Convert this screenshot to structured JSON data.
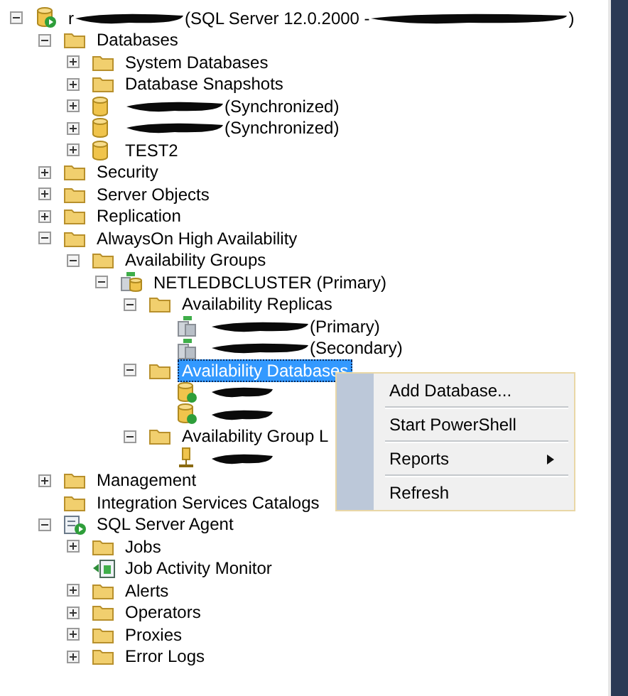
{
  "tree": [
    {
      "kind": "server",
      "expanded": true,
      "selected": false,
      "segments": [
        {
          "kind": "text",
          "text": "r"
        },
        {
          "kind": "redaction"
        },
        {
          "kind": "text",
          "text": "(SQL Server 12.0.2000 - "
        },
        {
          "kind": "redaction"
        },
        {
          "kind": "text",
          "text": ")"
        }
      ],
      "children": [
        {
          "kind": "folder",
          "expanded": true,
          "selected": false,
          "label": "Databases",
          "children": [
            {
              "kind": "folder",
              "expanded": false,
              "selected": false,
              "label": "System Databases"
            },
            {
              "kind": "folder",
              "expanded": false,
              "selected": false,
              "label": "Database Snapshots"
            },
            {
              "kind": "database",
              "expanded": false,
              "selected": false,
              "segments": [
                {
                  "kind": "redaction"
                },
                {
                  "kind": "text",
                  "text": "(Synchronized)"
                }
              ]
            },
            {
              "kind": "database",
              "expanded": false,
              "selected": false,
              "segments": [
                {
                  "kind": "redaction"
                },
                {
                  "kind": "text",
                  "text": "(Synchronized)"
                }
              ]
            },
            {
              "kind": "database",
              "expanded": false,
              "selected": false,
              "label": "TEST2"
            }
          ]
        },
        {
          "kind": "folder",
          "expanded": false,
          "selected": false,
          "label": "Security"
        },
        {
          "kind": "folder",
          "expanded": false,
          "selected": false,
          "label": "Server Objects"
        },
        {
          "kind": "folder",
          "expanded": false,
          "selected": false,
          "label": "Replication"
        },
        {
          "kind": "folder",
          "expanded": true,
          "selected": false,
          "label": "AlwaysOn High Availability",
          "children": [
            {
              "kind": "folder",
              "expanded": true,
              "selected": false,
              "label": "Availability Groups",
              "children": [
                {
                  "kind": "group",
                  "expanded": true,
                  "selected": false,
                  "label": "NETLEDBCLUSTER (Primary)",
                  "children": [
                    {
                      "kind": "folder",
                      "expanded": true,
                      "selected": false,
                      "label": "Availability Replicas",
                      "children": [
                        {
                          "kind": "replica",
                          "selected": false,
                          "segments": [
                            {
                              "kind": "redaction"
                            },
                            {
                              "kind": "text",
                              "text": "(Primary)"
                            }
                          ]
                        },
                        {
                          "kind": "replica",
                          "selected": false,
                          "segments": [
                            {
                              "kind": "redaction"
                            },
                            {
                              "kind": "text",
                              "text": "(Secondary)"
                            }
                          ]
                        }
                      ]
                    },
                    {
                      "kind": "folder",
                      "expanded": true,
                      "selected": true,
                      "label": "Availability Databases",
                      "children": [
                        {
                          "kind": "avdb",
                          "selected": false,
                          "segments": [
                            {
                              "kind": "redaction"
                            }
                          ]
                        },
                        {
                          "kind": "avdb",
                          "selected": false,
                          "segments": [
                            {
                              "kind": "redaction"
                            }
                          ]
                        }
                      ]
                    },
                    {
                      "kind": "folder",
                      "expanded": true,
                      "selected": false,
                      "label": "Availability Group L",
                      "children": [
                        {
                          "kind": "listener",
                          "selected": false,
                          "segments": [
                            {
                              "kind": "redaction"
                            }
                          ]
                        }
                      ]
                    }
                  ]
                }
              ]
            }
          ]
        },
        {
          "kind": "folder",
          "expanded": false,
          "selected": false,
          "label": "Management"
        },
        {
          "kind": "folder",
          "selected": false,
          "label": "Integration Services Catalogs"
        },
        {
          "kind": "agent",
          "expanded": true,
          "selected": false,
          "label": "SQL Server Agent",
          "children": [
            {
              "kind": "folder",
              "expanded": false,
              "selected": false,
              "label": "Jobs"
            },
            {
              "kind": "monitor",
              "selected": false,
              "label": "Job Activity Monitor"
            },
            {
              "kind": "folder",
              "expanded": false,
              "selected": false,
              "label": "Alerts"
            },
            {
              "kind": "folder",
              "expanded": false,
              "selected": false,
              "label": "Operators"
            },
            {
              "kind": "folder",
              "expanded": false,
              "selected": false,
              "label": "Proxies"
            },
            {
              "kind": "folder",
              "expanded": false,
              "selected": false,
              "label": "Error Logs"
            }
          ]
        }
      ]
    }
  ],
  "context_menu": {
    "items": [
      {
        "label": "Add Database...",
        "submenu": false
      },
      {
        "label": "Start PowerShell",
        "submenu": false
      },
      {
        "label": "Reports",
        "submenu": true
      },
      {
        "label": "Refresh",
        "submenu": false
      }
    ]
  }
}
